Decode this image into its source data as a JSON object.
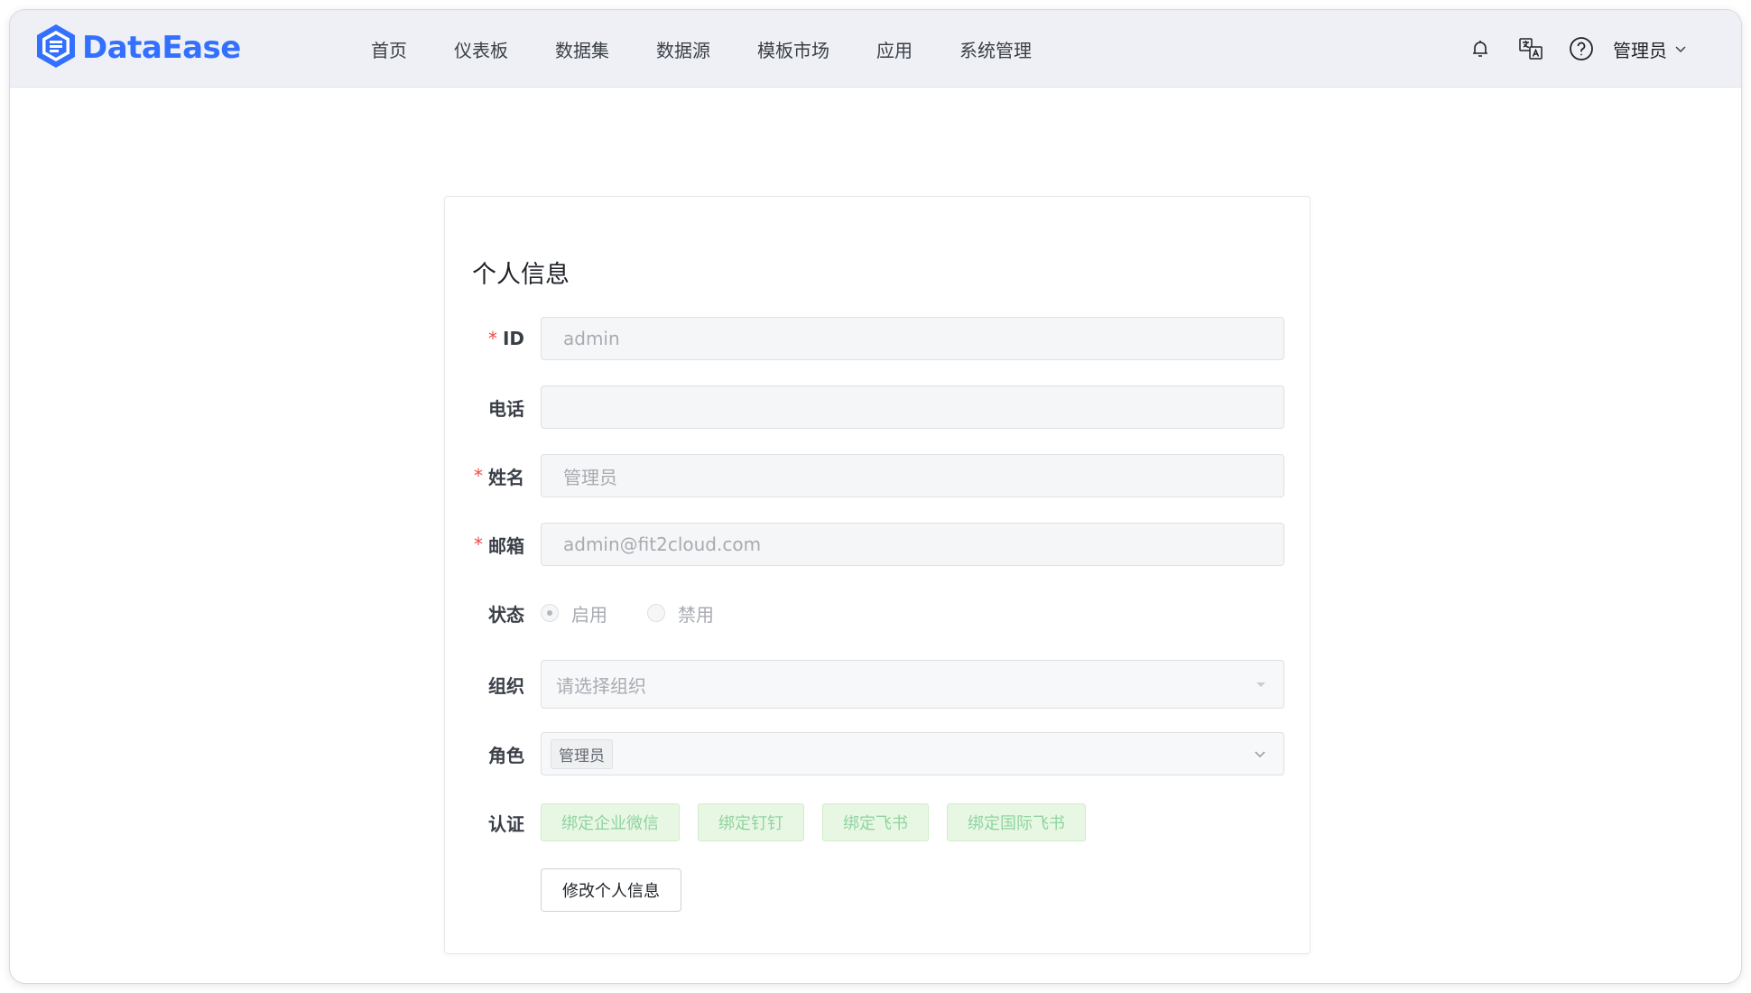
{
  "app": {
    "logo_text": "DataEase",
    "brand_color": "#3370ff"
  },
  "nav": {
    "items": [
      "首页",
      "仪表板",
      "数据集",
      "数据源",
      "模板市场",
      "应用",
      "系统管理"
    ]
  },
  "header_right": {
    "icons": [
      "bell-icon",
      "language-icon",
      "help-icon"
    ],
    "user": "管理员"
  },
  "form": {
    "title": "个人信息",
    "id_label": "ID",
    "id_value": "admin",
    "phone_label": "电话",
    "phone_value": "",
    "name_label": "姓名",
    "name_value": "管理员",
    "email_label": "邮箱",
    "email_value": "admin@fit2cloud.com",
    "status_label": "状态",
    "status_options": [
      "启用",
      "禁用"
    ],
    "status_selected": "启用",
    "org_label": "组织",
    "org_placeholder": "请选择组织",
    "role_label": "角色",
    "role_tag": "管理员",
    "auth_label": "认证",
    "auth_buttons": [
      "绑定企业微信",
      "绑定钉钉",
      "绑定飞书",
      "绑定国际飞书"
    ],
    "submit_label": "修改个人信息",
    "required_mark": "*"
  }
}
